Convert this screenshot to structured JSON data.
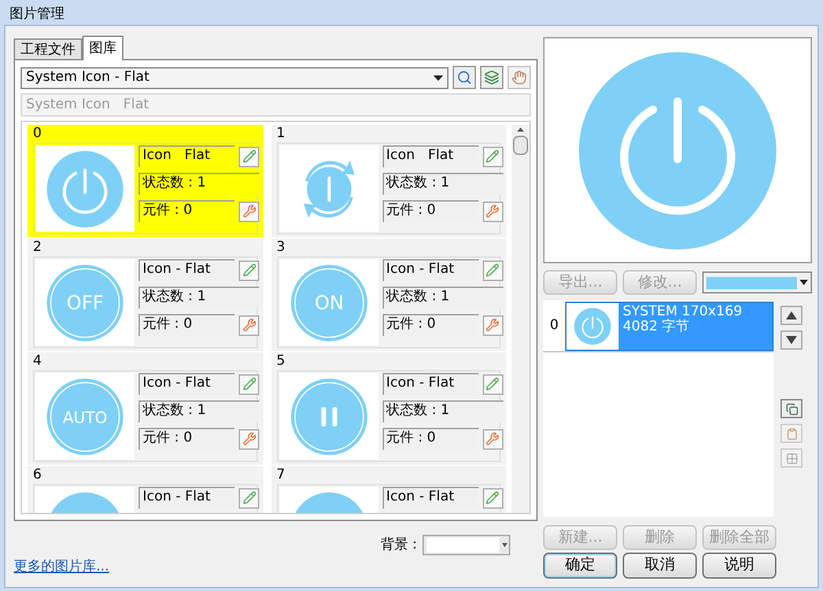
{
  "window": {
    "title": "图片管理"
  },
  "tabs": [
    {
      "label": "工程文件",
      "selected": false
    },
    {
      "label": "图库",
      "selected": true
    }
  ],
  "library": {
    "value": "System Icon - Flat",
    "path": "System Icon   Flat"
  },
  "cards": [
    {
      "index": "0",
      "selected": true,
      "icon": {
        "kind": "power"
      },
      "name": "Icon   Flat",
      "states": "状态数 : 1",
      "elements": "元件 : 0"
    },
    {
      "index": "1",
      "selected": false,
      "icon": {
        "kind": "cycle"
      },
      "name": "Icon   Flat",
      "states": "状态数 : 1",
      "elements": "元件 : 0"
    },
    {
      "index": "2",
      "selected": false,
      "icon": {
        "kind": "text",
        "label": "OFF"
      },
      "name": "Icon - Flat",
      "states": "状态数 : 1",
      "elements": "元件 : 0"
    },
    {
      "index": "3",
      "selected": false,
      "icon": {
        "kind": "text",
        "label": "ON"
      },
      "name": "Icon - Flat",
      "states": "状态数 : 1",
      "elements": "元件 : 0"
    },
    {
      "index": "4",
      "selected": false,
      "icon": {
        "kind": "text",
        "label": "AUTO"
      },
      "name": "Icon - Flat",
      "states": "状态数 : 1",
      "elements": "元件 : 0"
    },
    {
      "index": "5",
      "selected": false,
      "icon": {
        "kind": "pause"
      },
      "name": "Icon - Flat",
      "states": "状态数 : 1",
      "elements": "元件 : 0"
    },
    {
      "index": "6",
      "selected": false,
      "icon": {
        "kind": "circle"
      },
      "name": "Icon - Flat"
    },
    {
      "index": "7",
      "selected": false,
      "icon": {
        "kind": "circle"
      },
      "name": "Icon - Flat"
    }
  ],
  "background": {
    "label": "背景 :"
  },
  "more_link": "更多的图片库...",
  "preview": {
    "icon": {
      "kind": "power"
    }
  },
  "preview_buttons": [
    {
      "label": "导出...",
      "disabled": true
    },
    {
      "label": "修改...",
      "disabled": true
    }
  ],
  "color_swatch": {
    "color": "#7fd0f6"
  },
  "images": [
    {
      "index": "0",
      "selected": true,
      "icon": {
        "kind": "power"
      },
      "lines": [
        "SYSTEM 170x169",
        "4082 字节"
      ]
    }
  ],
  "list_buttons": [
    {
      "label": "新建...",
      "disabled": true
    },
    {
      "label": "删除",
      "disabled": true
    },
    {
      "label": "删除全部",
      "disabled": true
    }
  ],
  "dialog_buttons": [
    {
      "label": "确定",
      "default": true
    },
    {
      "label": "取消",
      "default": false
    },
    {
      "label": "说明",
      "default": false
    }
  ]
}
